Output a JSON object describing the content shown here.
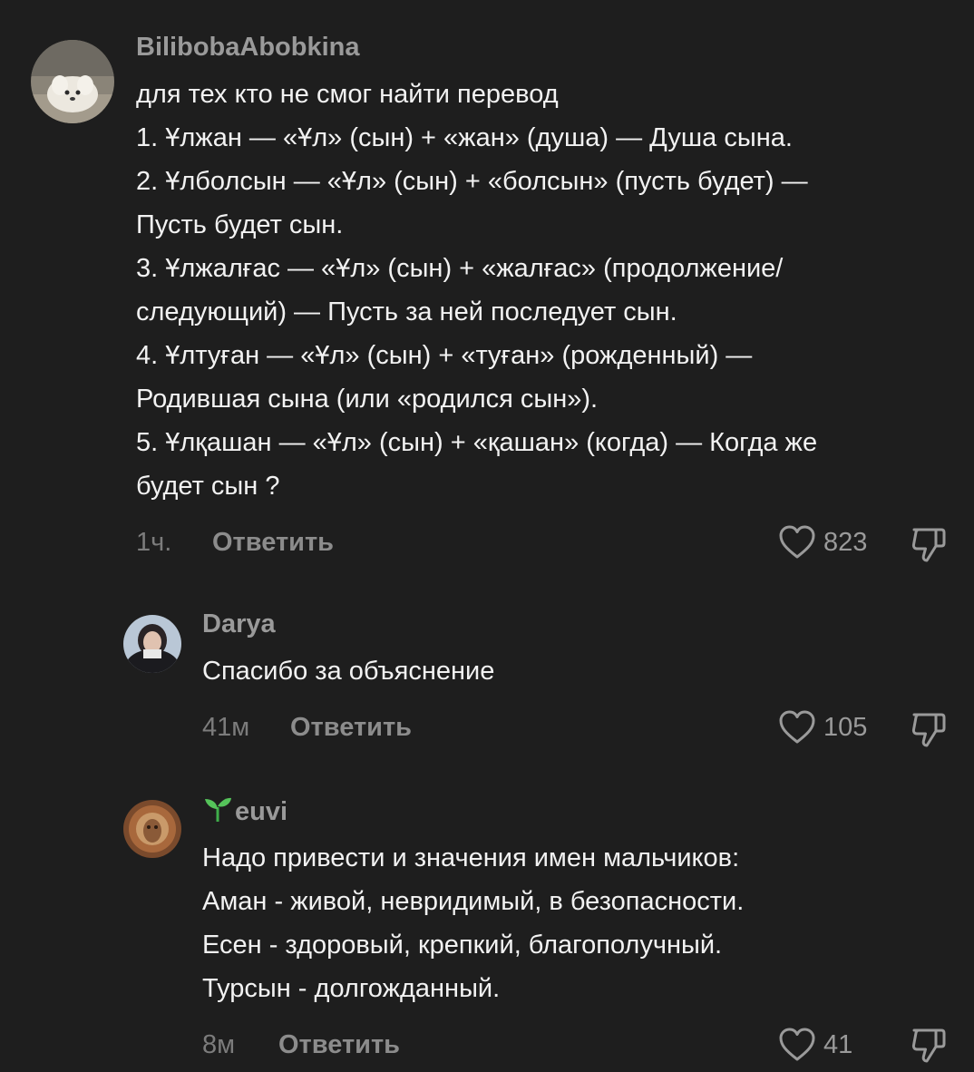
{
  "reply_label": "Ответить",
  "comments": [
    {
      "username": "BilibobaAbobkina",
      "lines": [
        "для тех кто не смог найти перевод",
        "1. Ұлжан — «Ұл» (сын) + «жан» (душа) — Душа сына.",
        "2. Ұлболсын — «Ұл» (сын) + «болсын» (пусть будет) —",
        "Пусть будет сын.",
        "3. Ұлжалғас — «Ұл» (сын) + «жалғас» (продолжение/",
        "следующий) — Пусть за ней последует сын.",
        "4. Ұлтуған — «Ұл» (сын) + «туған» (рожденный) —",
        "Родившая сына (или «родился сын»).",
        "5. Ұлқашан — «Ұл» (сын) + «қашан» (когда) — Когда же",
        "будет сын ?"
      ],
      "time": "1ч.",
      "likes": "823"
    },
    {
      "username": "Darya",
      "lines": [
        "Спасибо за объяснение"
      ],
      "time": "41м",
      "likes": "105"
    },
    {
      "username": "euvi",
      "lines": [
        "Надо привести и значения имен мальчиков:",
        "Аман - живой, невридимый, в безопасности.",
        "Есен - здоровый, крепкий, благополучный.",
        "Турсын - долгожданный."
      ],
      "time": "8м",
      "likes": "41"
    }
  ],
  "icons": {
    "like": "heart-outline-icon",
    "dislike": "thumbs-down-outline-icon",
    "username_prefix": "sprout-icon"
  },
  "colors": {
    "background": "#1e1e1e",
    "text": "#f2f2f2",
    "muted": "#9a9a9a"
  }
}
